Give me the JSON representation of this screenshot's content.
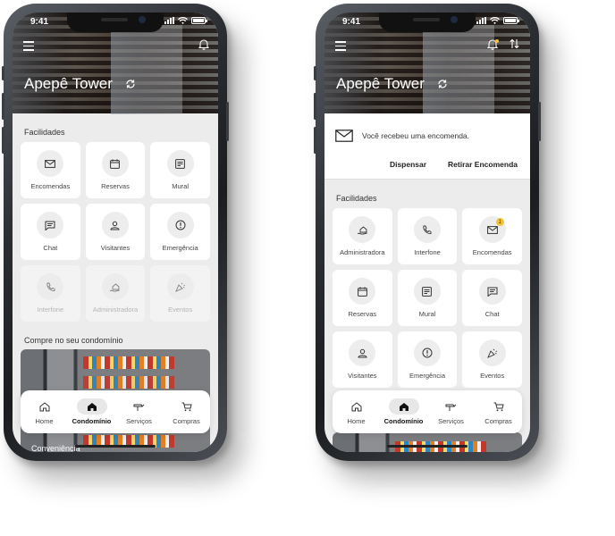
{
  "left_phone": {
    "status": {
      "time": "9:41"
    },
    "header": {
      "title": "Apepê Tower"
    },
    "facilities_title": "Facilidades",
    "facilities": [
      {
        "label": "Encomendas",
        "icon": "mail-icon"
      },
      {
        "label": "Reservas",
        "icon": "calendar-icon"
      },
      {
        "label": "Mural",
        "icon": "board-icon"
      },
      {
        "label": "Chat",
        "icon": "chat-icon"
      },
      {
        "label": "Visitantes",
        "icon": "person-icon"
      },
      {
        "label": "Emergência",
        "icon": "alert-icon"
      },
      {
        "label": "Interfone",
        "icon": "phone-icon"
      },
      {
        "label": "Administradora",
        "icon": "hand-house-icon"
      },
      {
        "label": "Eventos",
        "icon": "party-icon"
      }
    ],
    "store_title": "Compre no seu condomínio",
    "store_caption": "Conveniência",
    "nav": [
      {
        "label": "Home",
        "icon": "home-outline-icon"
      },
      {
        "label": "Condomínio",
        "icon": "home-filled-icon"
      },
      {
        "label": "Serviços",
        "icon": "service-icon"
      },
      {
        "label": "Compras",
        "icon": "cart-icon"
      }
    ]
  },
  "right_phone": {
    "status": {
      "time": "9:41"
    },
    "header": {
      "title": "Apepê Tower"
    },
    "notification": {
      "text": "Você recebeu uma encomenda.",
      "dismiss_label": "Dispensar",
      "action_label": "Retirar Encomenda"
    },
    "facilities_title": "Facilidades",
    "facilities": [
      {
        "label": "Administradora",
        "icon": "hand-house-icon"
      },
      {
        "label": "Interfone",
        "icon": "phone-icon"
      },
      {
        "label": "Encomendas",
        "icon": "mail-icon",
        "badge": "1"
      },
      {
        "label": "Reservas",
        "icon": "calendar-icon"
      },
      {
        "label": "Mural",
        "icon": "board-icon"
      },
      {
        "label": "Chat",
        "icon": "chat-icon"
      },
      {
        "label": "Visitantes",
        "icon": "person-icon"
      },
      {
        "label": "Emergência",
        "icon": "alert-icon"
      },
      {
        "label": "Eventos",
        "icon": "party-icon"
      }
    ],
    "nav": [
      {
        "label": "Home",
        "icon": "home-outline-icon"
      },
      {
        "label": "Condomínio",
        "icon": "home-filled-icon"
      },
      {
        "label": "Serviços",
        "icon": "service-icon"
      },
      {
        "label": "Compras",
        "icon": "cart-icon"
      }
    ]
  },
  "colors": {
    "accent_badge": "#f1c232",
    "tile_bg": "#ffffff",
    "screen_bg": "#ececec"
  }
}
